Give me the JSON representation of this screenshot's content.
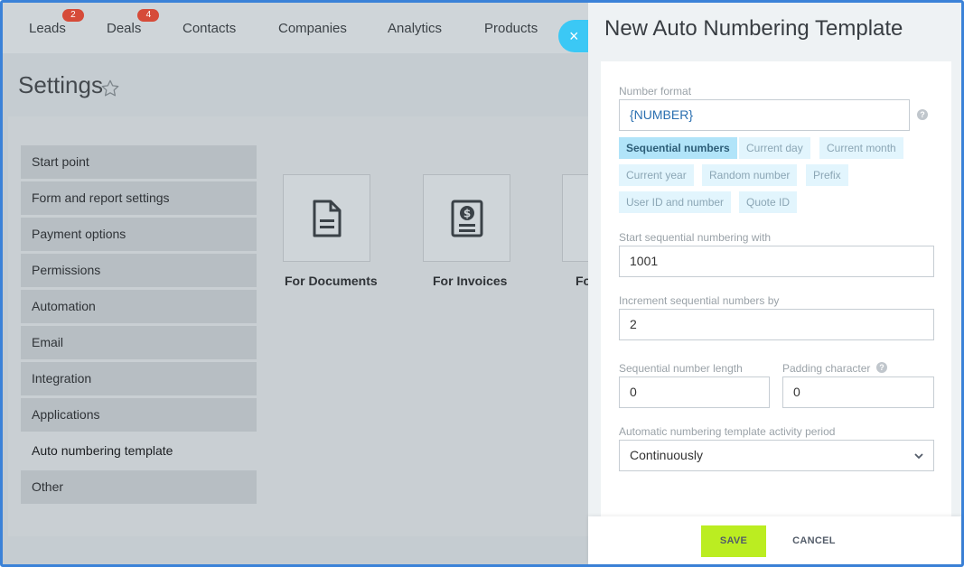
{
  "nav": {
    "items": [
      {
        "label": "Leads",
        "badge": "2"
      },
      {
        "label": "Deals",
        "badge": "4"
      },
      {
        "label": "Contacts"
      },
      {
        "label": "Companies"
      },
      {
        "label": "Analytics"
      },
      {
        "label": "Products"
      }
    ]
  },
  "page": {
    "title": "Settings"
  },
  "sidebar": {
    "items": [
      {
        "label": "Start point"
      },
      {
        "label": "Form and report settings"
      },
      {
        "label": "Payment options"
      },
      {
        "label": "Permissions"
      },
      {
        "label": "Automation"
      },
      {
        "label": "Email"
      },
      {
        "label": "Integration"
      },
      {
        "label": "Applications"
      },
      {
        "label": "Auto numbering template",
        "active": true
      },
      {
        "label": "Other"
      }
    ]
  },
  "tiles": [
    {
      "label": "For Documents",
      "icon": "document-icon"
    },
    {
      "label": "For Invoices",
      "icon": "invoice-icon"
    },
    {
      "label": "Fo"
    }
  ],
  "panel": {
    "title": "New Auto Numbering Template",
    "close_label": "×",
    "number_format": {
      "label": "Number format",
      "value": "{NUMBER}",
      "help": "?",
      "chips": [
        {
          "label": "Sequential numbers",
          "selected": true
        },
        {
          "label": "Current day"
        },
        {
          "label": "Current month"
        },
        {
          "label": "Current year"
        },
        {
          "label": "Random number"
        },
        {
          "label": "Prefix"
        },
        {
          "label": "User ID and number"
        },
        {
          "label": "Quote ID"
        }
      ]
    },
    "start_with": {
      "label": "Start sequential numbering with",
      "value": "1001"
    },
    "increment": {
      "label": "Increment sequential numbers by",
      "value": "2"
    },
    "length": {
      "label": "Sequential number length",
      "value": "0"
    },
    "padding": {
      "label": "Padding character",
      "value": "0",
      "help": "?"
    },
    "activity": {
      "label": "Automatic numbering template activity period",
      "value": "Continuously"
    },
    "save_label": "SAVE",
    "cancel_label": "CANCEL"
  },
  "colors": {
    "accent": "#3bc8f5",
    "save": "#bbed21",
    "chip_selected": "#b1e4f9",
    "chip": "#e2f5fd",
    "frame_border": "#3b82d8",
    "badge": "#d64b39"
  }
}
